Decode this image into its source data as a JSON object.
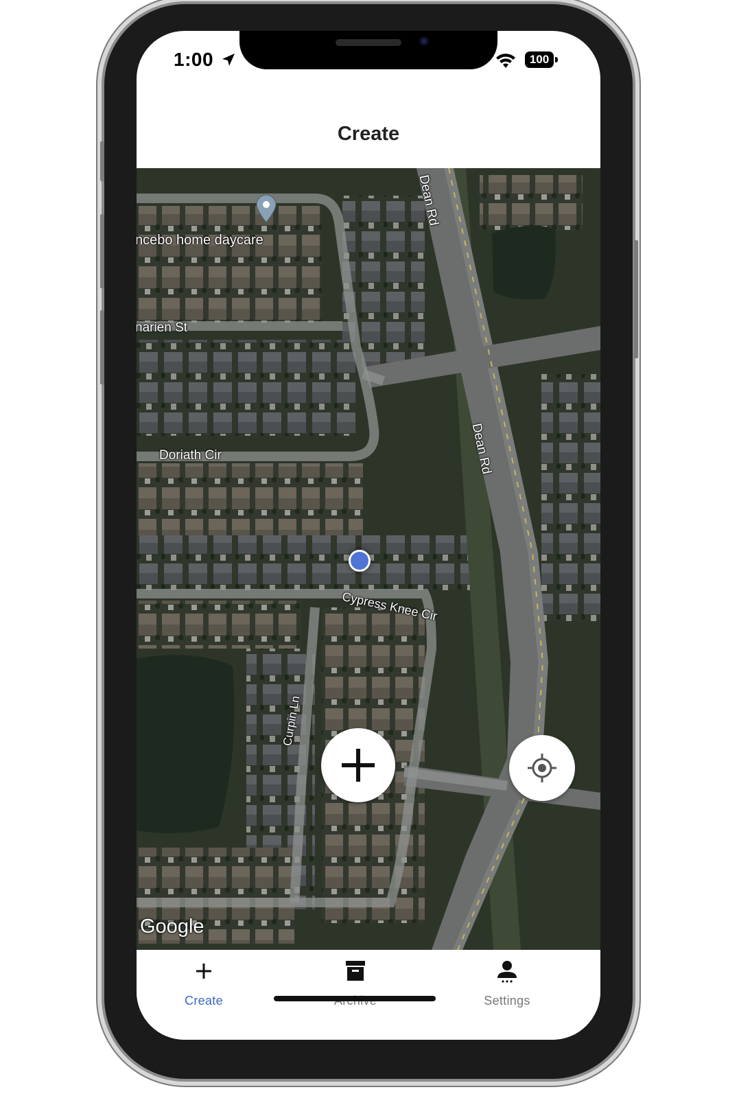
{
  "status_bar": {
    "time": "1:00",
    "battery": "100",
    "icons": [
      "location-arrow-icon",
      "wifi-icon",
      "battery-icon"
    ]
  },
  "header": {
    "title": "Create"
  },
  "map": {
    "labels": {
      "place": "ncebo home daycare",
      "street_1": "narien St",
      "street_2": "Doriath Cir",
      "street_3": "Cypress Knee Cir",
      "street_4": "Curpin Ln",
      "street_5": "Dean Rd",
      "street_6": "Dean Rd"
    },
    "attribution": "Google"
  },
  "fab": {
    "add_icon": "plus-icon",
    "locate_icon": "my-location-icon"
  },
  "tabs": [
    {
      "label": "Create",
      "icon": "plus-icon",
      "active": true
    },
    {
      "label": "Archive",
      "icon": "archive-icon",
      "active": false
    },
    {
      "label": "Settings",
      "icon": "person-icon",
      "active": false
    }
  ],
  "colors": {
    "accent": "#3c66c0",
    "inactive": "#777777",
    "location_dot": "#4f74d6"
  }
}
